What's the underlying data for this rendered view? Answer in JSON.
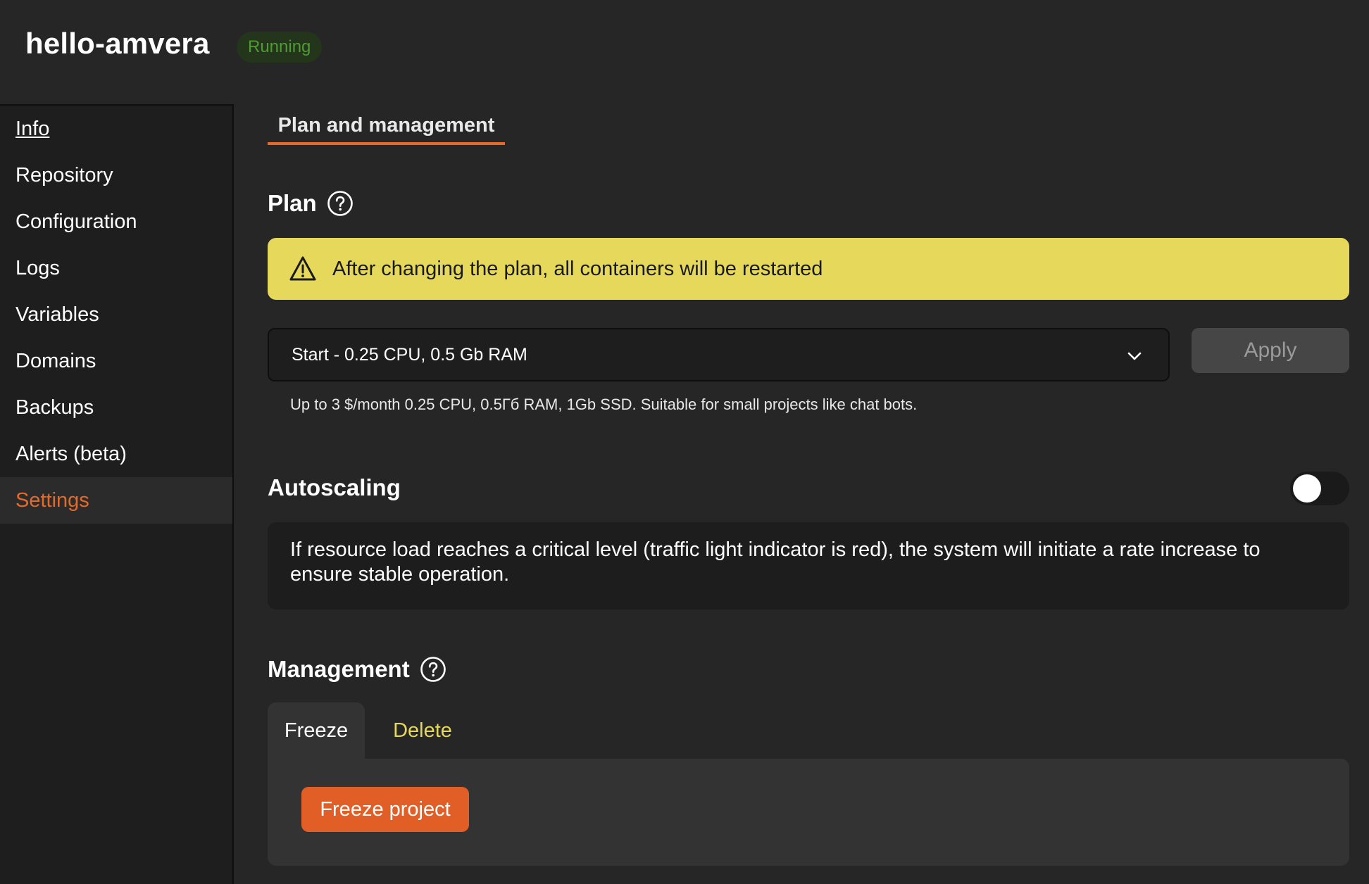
{
  "header": {
    "title": "hello-amvera",
    "status": "Running"
  },
  "sidebar": {
    "items": [
      {
        "label": "Info"
      },
      {
        "label": "Repository"
      },
      {
        "label": "Configuration"
      },
      {
        "label": "Logs"
      },
      {
        "label": "Variables"
      },
      {
        "label": "Domains"
      },
      {
        "label": "Backups"
      },
      {
        "label": "Alerts (beta)"
      },
      {
        "label": "Settings"
      }
    ],
    "active": "Settings"
  },
  "main": {
    "tab": "Plan and management",
    "plan": {
      "title": "Plan",
      "warning": "After changing the plan, all containers will be restarted",
      "selected": "Start - 0.25 CPU, 0.5 Gb RAM",
      "apply_label": "Apply",
      "hint": "Up to 3 $/month 0.25 CPU, 0.5Гб RAM, 1Gb SSD. Suitable for small projects like chat bots."
    },
    "autoscaling": {
      "title": "Autoscaling",
      "enabled": false,
      "description": "If resource load reaches a critical level (traffic light indicator is red), the system will initiate a rate increase to ensure stable operation."
    },
    "management": {
      "title": "Management",
      "tabs": [
        "Freeze",
        "Delete"
      ],
      "active_tab": "Freeze",
      "freeze_button": "Freeze project"
    }
  },
  "colors": {
    "accent": "#e56a2a",
    "warning": "#e5d85a",
    "status": "#4f9a33"
  }
}
